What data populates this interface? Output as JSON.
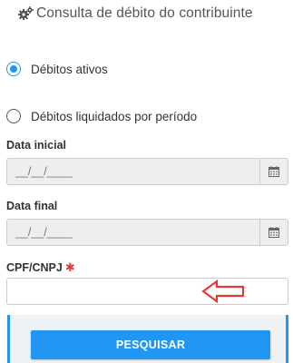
{
  "header": {
    "title": "Consulta de débito do contribuinte",
    "icon": "gears-icon"
  },
  "options": [
    {
      "label": "Débitos ativos",
      "checked": true
    },
    {
      "label": "Débitos liquidados por período",
      "checked": false
    }
  ],
  "data_inicial": {
    "label": "Data inicial",
    "placeholder": "__/__/____",
    "icon": "calendar-icon"
  },
  "data_final": {
    "label": "Data final",
    "placeholder": "__/__/____",
    "icon": "calendar-icon"
  },
  "cpf_cnpj": {
    "label": "CPF/CNPJ",
    "required_mark": "✱",
    "value": ""
  },
  "annotation": {
    "icon": "red-arrow-left-icon",
    "color": "#e53935"
  },
  "search_button": {
    "label": "PESQUISAR"
  },
  "colors": {
    "accent": "#2196f3",
    "required": "#e53935"
  }
}
